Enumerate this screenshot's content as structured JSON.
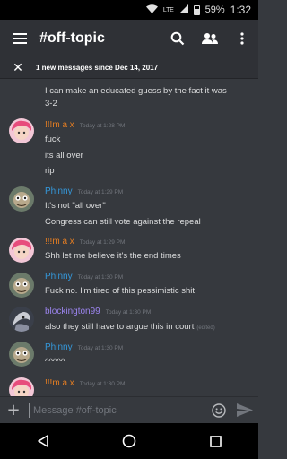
{
  "status_bar": {
    "network": "LTE",
    "battery": "59%",
    "time": "1:32"
  },
  "app_bar": {
    "title": "#off-topic",
    "menu_icon": "hamburger-menu-icon",
    "search_icon": "search-icon",
    "members_icon": "members-icon",
    "overflow_icon": "more-vertical-icon"
  },
  "new_messages": {
    "text": "1 new messages since Dec 14, 2017"
  },
  "messages": [
    {
      "lines": [
        "I can make an educated guess by the fact it was",
        "3-2"
      ]
    },
    {
      "author": "!!!m a x",
      "timestamp": "Today at 1:28 PM",
      "color": "#e67e22",
      "lines": [
        "fuck",
        "its all over",
        "rip"
      ]
    },
    {
      "author": "Phinny",
      "timestamp": "Today at 1:29 PM",
      "color": "#3498db",
      "lines": [
        "It's not \"all over\"",
        "Congress can still vote against the repeal"
      ]
    },
    {
      "author": "!!!m a x",
      "timestamp": "Today at 1:29 PM",
      "color": "#e67e22",
      "lines": [
        "Shh let me believe it's the end times"
      ]
    },
    {
      "author": "Phinny",
      "timestamp": "Today at 1:30 PM",
      "color": "#3498db",
      "lines": [
        "Fuck no. I'm tired of this pessimistic shit"
      ]
    },
    {
      "author": "blockington99",
      "timestamp": "Today at 1:30 PM",
      "color": "#9b84ee",
      "lines": [
        "also they still have to argue this in court"
      ],
      "edited": "(edited)"
    },
    {
      "author": "Phinny",
      "timestamp": "Today at 1:30 PM",
      "color": "#3498db",
      "lines": [
        "^^^^^"
      ]
    },
    {
      "author": "!!!m a x",
      "timestamp": "Today at 1:30 PM",
      "color": "#e67e22",
      "lines": []
    }
  ],
  "composer": {
    "placeholder": "Message #off-topic"
  }
}
